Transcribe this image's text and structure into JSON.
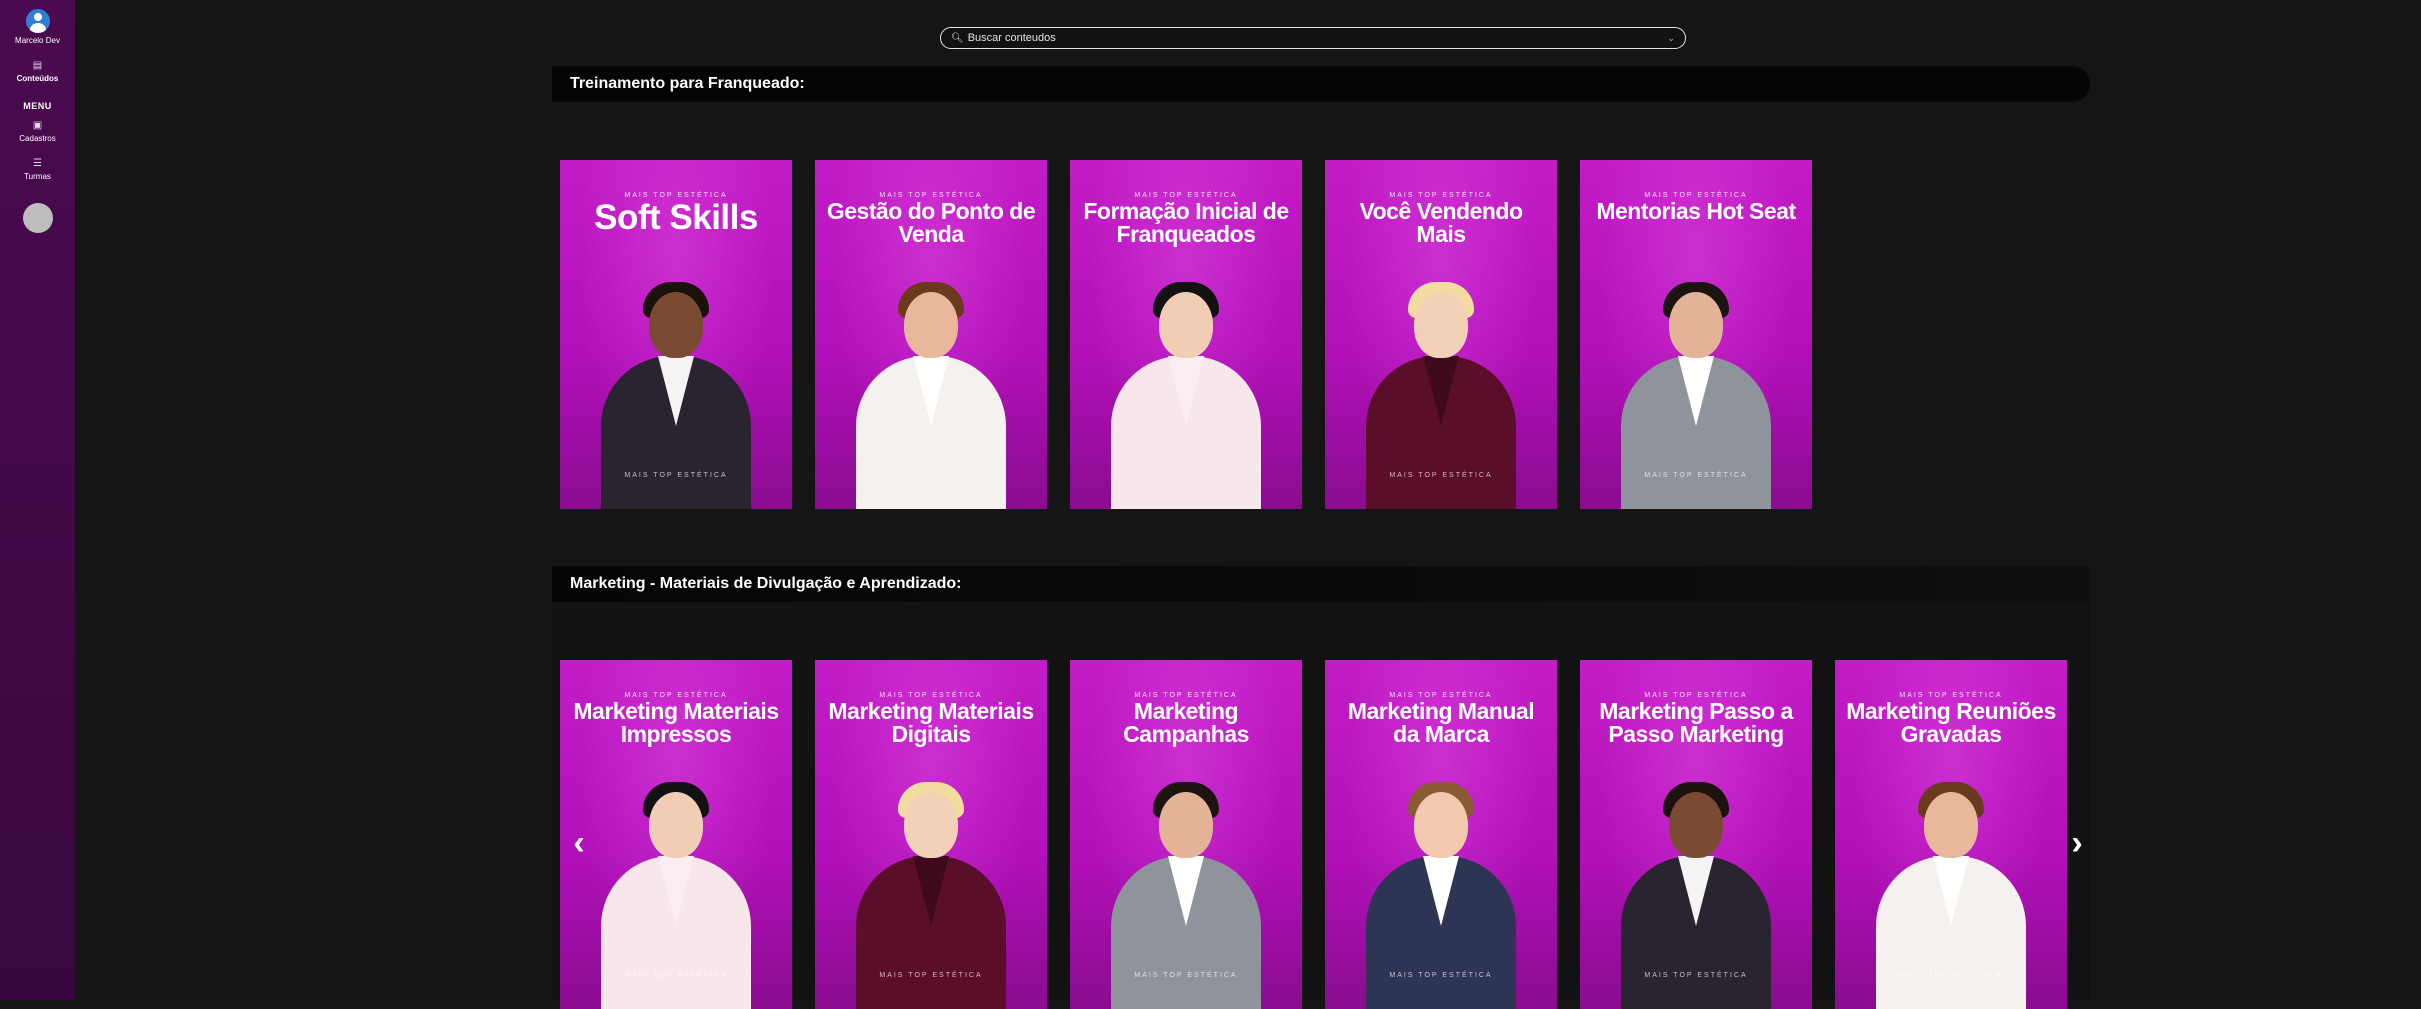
{
  "sidebar": {
    "user_name": "Marcelo Dev",
    "conteudos_label": "Conteúdos",
    "menu_title": "MENU",
    "cadastros_label": "Cadastros",
    "turmas_label": "Turmas"
  },
  "search": {
    "placeholder": "Buscar conteudos"
  },
  "sections": [
    {
      "title": "Treinamento para Franqueado:",
      "cards": [
        {
          "brand": "MAIS TOP ESTÉTICA",
          "title": "Soft  Skills",
          "brand_bottom": "MAIS TOP ESTÉTICA"
        },
        {
          "brand": "MAIS TOP ESTÉTICA",
          "title": "Gestão do Ponto de Venda",
          "brand_bottom": ""
        },
        {
          "brand": "MAIS TOP ESTÉTICA",
          "title": "Formação Inicial de Franqueados",
          "brand_bottom": ""
        },
        {
          "brand": "MAIS TOP ESTÉTICA",
          "title": "Você Vendendo Mais",
          "brand_bottom": "MAIS TOP ESTÉTICA"
        },
        {
          "brand": "MAIS TOP ESTÉTICA",
          "title": "Mentorias Hot Seat",
          "brand_bottom": "MAIS TOP ESTÉTICA"
        }
      ]
    },
    {
      "title": "Marketing - Materiais de Divulgação e Aprendizado:",
      "cards": [
        {
          "brand": "MAIS TOP ESTÉTICA",
          "title": "Marketing Materiais Impressos",
          "brand_bottom": "MAIS TOP ESTÉTICA"
        },
        {
          "brand": "MAIS TOP ESTÉTICA",
          "title": "Marketing Materiais Digitais",
          "brand_bottom": "MAIS TOP ESTÉTICA"
        },
        {
          "brand": "MAIS TOP ESTÉTICA",
          "title": "Marketing Campanhas",
          "brand_bottom": "MAIS TOP ESTÉTICA"
        },
        {
          "brand": "MAIS TOP ESTÉTICA",
          "title": "Marketing Manual da Marca",
          "brand_bottom": "MAIS TOP ESTÉTICA"
        },
        {
          "brand": "MAIS TOP ESTÉTICA",
          "title": "Marketing Passo a Passo Marketing",
          "brand_bottom": "MAIS TOP ESTÉTICA"
        },
        {
          "brand": "MAIS TOP ESTÉTICA",
          "title": "Marketing Reuniões Gravadas",
          "brand_bottom": "MAIS TOP ESTÉTICA"
        }
      ]
    }
  ],
  "carousel": {
    "prev_glyph": "‹",
    "next_glyph": "›"
  },
  "colors": {
    "sidebar": "#4a0a4f",
    "card": "#c21cc6",
    "background": "#151515"
  }
}
